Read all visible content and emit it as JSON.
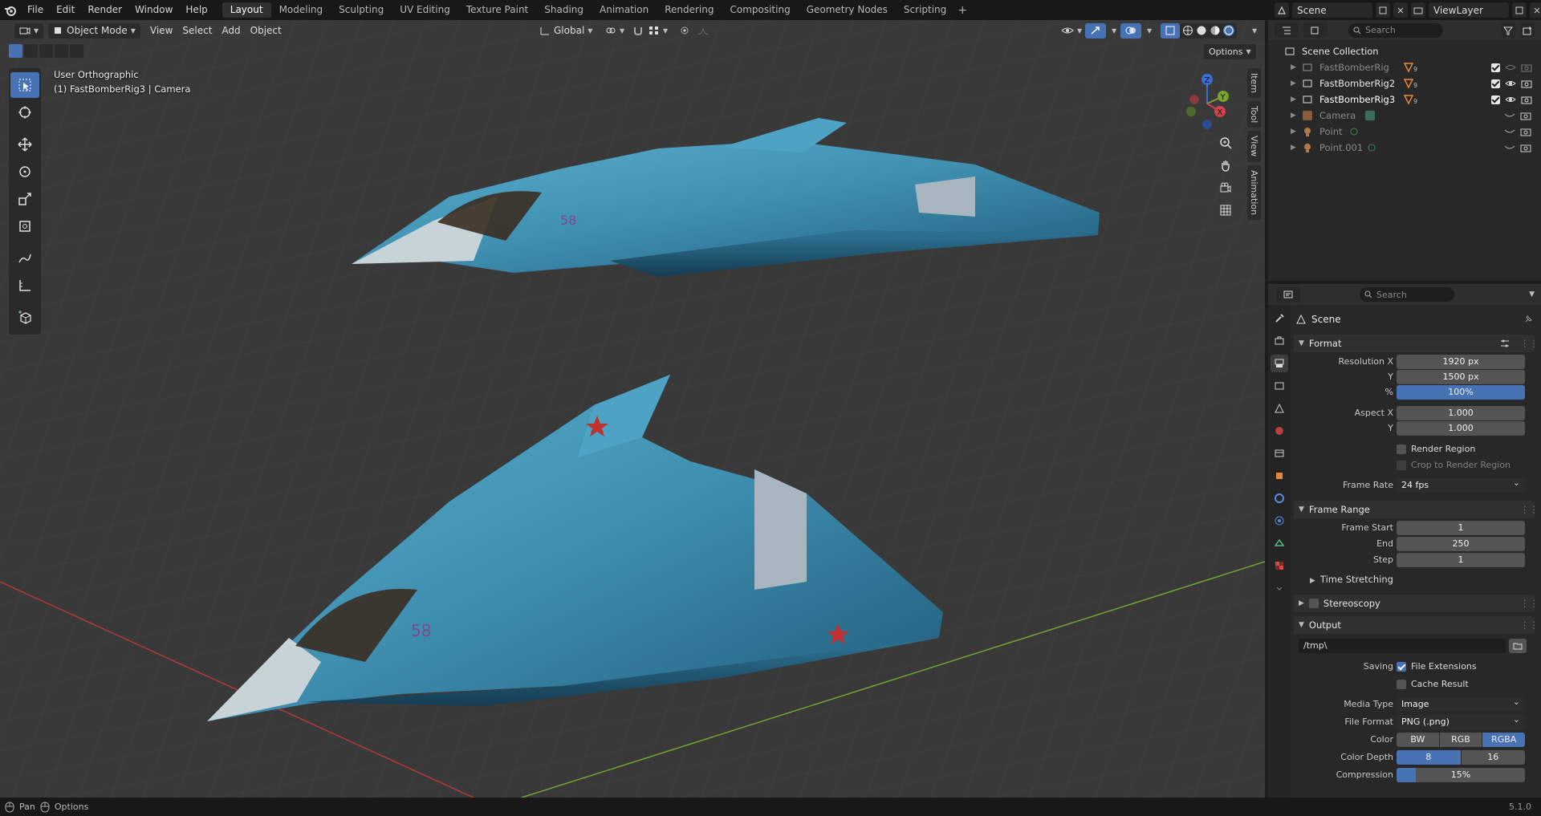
{
  "topbar": {
    "menus": [
      "File",
      "Edit",
      "Render",
      "Window",
      "Help"
    ],
    "workspaces": [
      "Layout",
      "Modeling",
      "Sculpting",
      "UV Editing",
      "Texture Paint",
      "Shading",
      "Animation",
      "Rendering",
      "Compositing",
      "Geometry Nodes",
      "Scripting"
    ],
    "active_workspace": "Layout",
    "scene": "Scene",
    "view_layer": "ViewLayer"
  },
  "viewport": {
    "mode": "Object Mode",
    "menus": [
      "View",
      "Select",
      "Add",
      "Object"
    ],
    "transform_orientation": "Global",
    "options_label": "Options",
    "view_name": "User Orthographic",
    "active_info": "(1) FastBomberRig3 | Camera",
    "side_tabs": [
      "Item",
      "Tool",
      "View",
      "Animation"
    ],
    "aircraft_number": "58",
    "colors": {
      "body": "#3f8fb1",
      "grid_x": "#b23a3a",
      "grid_y": "#79a133",
      "star": "#c0312f"
    }
  },
  "outliner": {
    "search_placeholder": "Search",
    "root": "Scene Collection",
    "items": [
      {
        "name": "FastBomberRig",
        "icon": "armature-icon",
        "count": "9",
        "dim": true
      },
      {
        "name": "FastBomberRig2",
        "icon": "armature-icon",
        "count": "9",
        "dim": false
      },
      {
        "name": "FastBomberRig3",
        "icon": "armature-icon",
        "count": "9",
        "dim": false
      },
      {
        "name": "Camera",
        "icon": "camera-icon",
        "dim": true
      },
      {
        "name": "Point",
        "icon": "light-icon",
        "dim": true
      },
      {
        "name": "Point.001",
        "icon": "light-icon",
        "dim": true
      }
    ]
  },
  "properties": {
    "search_placeholder": "Search",
    "context": "Scene",
    "format": {
      "title": "Format",
      "resolution_x_label": "Resolution X",
      "resolution_x": "1920 px",
      "y_label": "Y",
      "resolution_y": "1500 px",
      "pct_label": "%",
      "resolution_pct": "100%",
      "aspect_x_label": "Aspect X",
      "aspect_x": "1.000",
      "aspect_y_label": "Y",
      "aspect_y": "1.000",
      "render_region": "Render Region",
      "crop_region": "Crop to Render Region",
      "frame_rate_label": "Frame Rate",
      "frame_rate": "24 fps"
    },
    "frame_range": {
      "title": "Frame Range",
      "start_label": "Frame Start",
      "start": "1",
      "end_label": "End",
      "end": "250",
      "step_label": "Step",
      "step": "1",
      "time_stretching": "Time Stretching"
    },
    "stereoscopy": "Stereoscopy",
    "output": {
      "title": "Output",
      "path": "/tmp\\",
      "saving_label": "Saving",
      "file_extensions": "File Extensions",
      "cache_result": "Cache Result",
      "media_type_label": "Media Type",
      "media_type": "Image",
      "file_format_label": "File Format",
      "file_format": "PNG (.png)",
      "color_label": "Color",
      "color_options": [
        "BW",
        "RGB",
        "RGBA"
      ],
      "color_selected": "RGBA",
      "depth_label": "Color Depth",
      "depth_options": [
        "8",
        "16"
      ],
      "depth_selected": "8",
      "compression_label": "Compression",
      "compression": "15%"
    }
  },
  "statusbar": {
    "pan": "Pan",
    "options": "Options",
    "version": "5.1.0"
  }
}
